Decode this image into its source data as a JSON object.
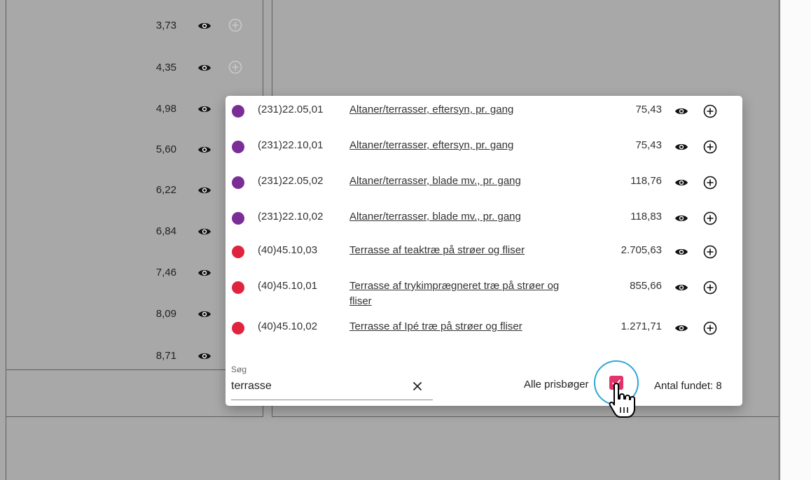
{
  "background": {
    "prices": [
      "3,73",
      "4,35",
      "4,98",
      "5,60",
      "6,22",
      "6,84",
      "7,46",
      "8,09",
      "8,71"
    ]
  },
  "dialog": {
    "results": [
      {
        "code": "(231)22.05,01",
        "desc": "Altaner/terrasser, eftersyn, pr. gang",
        "price": "75,43",
        "color": "#7b2d96"
      },
      {
        "code": "(231)22.10,01",
        "desc": "Altaner/terrasser, eftersyn, pr. gang",
        "price": "75,43",
        "color": "#7b2d96"
      },
      {
        "code": "(231)22.05,02",
        "desc": "Altaner/terrasser, blade mv., pr. gang",
        "price": "118,76",
        "color": "#7b2d96"
      },
      {
        "code": "(231)22.10,02",
        "desc": "Altaner/terrasser, blade mv., pr. gang",
        "price": "118,83",
        "color": "#7b2d96"
      },
      {
        "code": "(40)45.10,03",
        "desc": "Terrasse af teaktræ på strøer og fliser",
        "price": "2.705,63",
        "color": "#e0243f"
      },
      {
        "code": "(40)45.10,01",
        "desc": "Terrasse af trykimprægneret træ på strøer og fliser",
        "price": "855,66",
        "color": "#e0243f"
      },
      {
        "code": "(40)45.10,02",
        "desc": "Terrasse af Ipé træ på strøer og fliser",
        "price": "1.271,71",
        "color": "#e0243f"
      }
    ],
    "search": {
      "label": "Søg",
      "value": "terrasse"
    },
    "alle_prisboger": {
      "label": "Alle prisbøger",
      "checked": true
    },
    "antal_fundet": "Antal fundet: 8"
  },
  "icons": {
    "eye": "eye-icon",
    "plus": "plus-circle-icon",
    "clear": "close-icon",
    "check": "check-icon",
    "cursor": "hand-pointer-icon"
  },
  "colors": {
    "accent": "#e2336b",
    "focus": "#2ea6d7",
    "purple": "#7b2d96",
    "red": "#e0243f"
  }
}
